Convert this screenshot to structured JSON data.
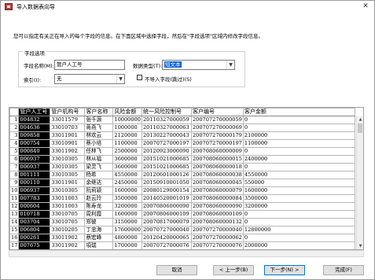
{
  "window": {
    "title": "导入数据表向导",
    "close_glyph": "✕"
  },
  "instruction": "您可以指定有关正在导入的每个字段的信息。在下面区域中选择字段，然后在\"字段选项\"区域内修改字段信息。",
  "field_options": {
    "group_label": "字段选项",
    "field_name_label": "字段名称(M):",
    "field_name_value": "管户人工号",
    "data_type_label": "数据类型(T):",
    "data_type_value": "短文本",
    "index_label": "索引(I):",
    "index_value": "无",
    "skip_label": "不导入字段(跳过)(S)"
  },
  "table": {
    "columns": [
      "管户人工号",
      "管户机构号",
      "客户名称",
      "风险金额",
      "统一风险控制号",
      "客户编号",
      "客户金额"
    ],
    "rows": [
      [
        "1",
        "004832",
        "33011579",
        "张千源",
        "10000000",
        "20110327000059",
        "200707270000059",
        "0"
      ],
      [
        "2",
        "004636",
        "33010703",
        "蒋燕飞",
        "1000000",
        "20110327000063",
        "200707270000069",
        "0"
      ],
      [
        "3",
        "009858",
        "33011901",
        "林欢云",
        "2120000",
        "20130227000043",
        "200707270000179",
        "2100000"
      ],
      [
        "4",
        "000754",
        "33010901",
        "蔡小培",
        "1100000",
        "20070727000197",
        "200707270000197",
        "1100000"
      ],
      [
        "5",
        "000840",
        "33011902",
        "任林飞",
        "2500000",
        "20120923000090",
        "200708060000009",
        "0"
      ],
      [
        "6",
        "006937",
        "33010305",
        "林从福",
        "3600000",
        "20151021000685",
        "200708060000015",
        "2400000"
      ],
      [
        "7",
        "006937",
        "33010305",
        "梁灵飞",
        "3600000",
        "20151021000685",
        "200708060000018",
        "0"
      ],
      [
        "8",
        "001111",
        "33010305",
        "杨希",
        "4550000",
        "20120601000126",
        "200708060000038",
        "4550000"
      ],
      [
        "9",
        "000110",
        "33011901",
        "余继达",
        "2450000",
        "20150910001050",
        "200708060000045",
        "550000"
      ],
      [
        "10",
        "006937",
        "33010305",
        "阮莉颖",
        "1600000",
        "20080129000154",
        "200708060000079",
        "1600000"
      ],
      [
        "11",
        "007783",
        "33011003",
        "赵云玲",
        "3500000",
        "20140520001019",
        "200708060000084",
        "3500000"
      ],
      [
        "12",
        "000604",
        "33011003",
        "陈寿龙",
        "3200000",
        "20070806000090",
        "200708060000090",
        "3200000"
      ],
      [
        "13",
        "010718",
        "33010705",
        "周利霞",
        "1600000",
        "20070806000109",
        "200708060000109",
        "0"
      ],
      [
        "14",
        "003704",
        "33010705",
        "郑彼",
        "3150000",
        "20070817000079",
        "200708060000132",
        "0"
      ],
      [
        "15",
        "006804",
        "33010205",
        "丁忠海",
        "17600000",
        "20070727000040",
        "200707270000040",
        "12800000"
      ],
      [
        "16",
        "000261",
        "33011902",
        "蔡宏峰",
        "4800000",
        "20120420000065",
        "200707270000062",
        "0"
      ],
      [
        "17",
        "007675",
        "33011902",
        "項瑞",
        "1700000",
        "20070727000076",
        "200707270000076",
        "2000000"
      ]
    ]
  },
  "buttons": {
    "cancel": "取消",
    "back": "< 上一步(B)",
    "next": "下一步(N) >",
    "finish": "完成(F)"
  },
  "colors": {
    "selection": "#000000",
    "accent": "#0a64d6",
    "default_border": "#0078d7"
  }
}
